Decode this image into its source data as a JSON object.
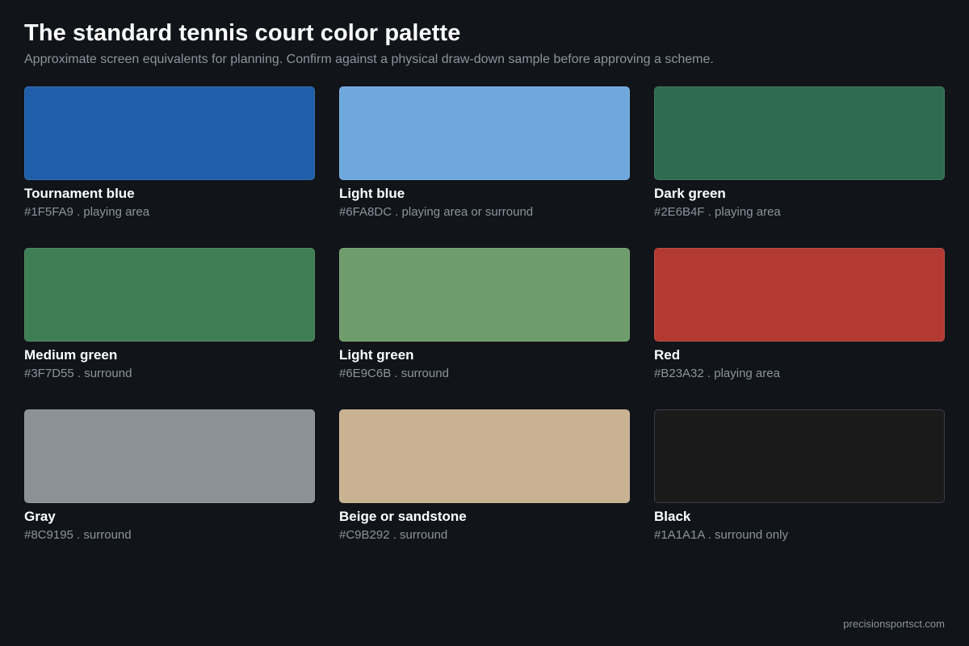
{
  "header": {
    "title": "The standard tennis court color palette",
    "subtitle": "Approximate screen equivalents for planning. Confirm against a physical draw-down sample before approving a scheme."
  },
  "colors": [
    {
      "name": "Tournament blue",
      "hex": "#1F5FA9",
      "meta": "#1F5FA9 . playing area"
    },
    {
      "name": "Light blue",
      "hex": "#6FA8DC",
      "meta": "#6FA8DC . playing area or surround"
    },
    {
      "name": "Dark green",
      "hex": "#2E6B4F",
      "meta": "#2E6B4F . playing area"
    },
    {
      "name": "Medium green",
      "hex": "#3F7D55",
      "meta": "#3F7D55 . surround"
    },
    {
      "name": "Light green",
      "hex": "#6E9C6B",
      "meta": "#6E9C6B . surround"
    },
    {
      "name": "Red",
      "hex": "#B23A32",
      "meta": "#B23A32 . playing area"
    },
    {
      "name": "Gray",
      "hex": "#8C9195",
      "meta": "#8C9195 . surround"
    },
    {
      "name": "Beige or sandstone",
      "hex": "#C9B292",
      "meta": "#C9B292 . surround"
    },
    {
      "name": "Black",
      "hex": "#1A1A1A",
      "meta": "#1A1A1A . surround only"
    }
  ],
  "footer": {
    "site": "precisionsportsct.com"
  }
}
